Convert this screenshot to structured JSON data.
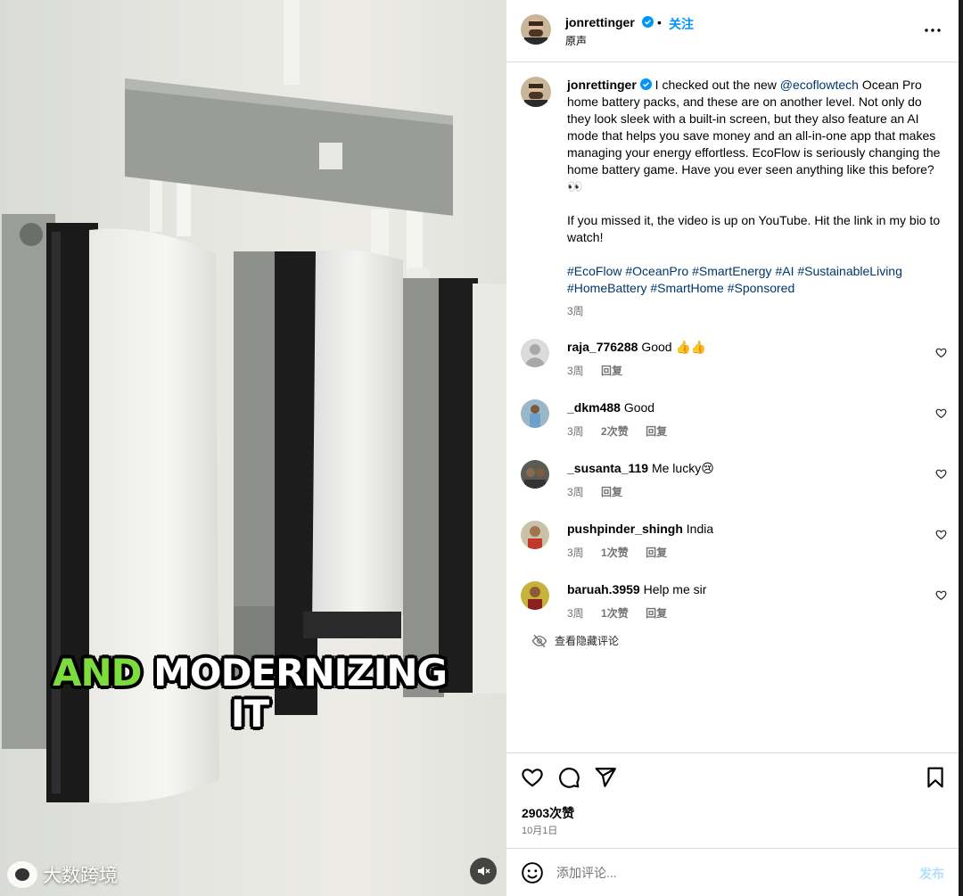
{
  "media": {
    "caption_accent": "AND",
    "caption_rest": "MODERNIZING",
    "caption_line2": "IT",
    "watermark": "大数跨境",
    "mute_icon": "speaker-muted-icon"
  },
  "header": {
    "username": "jonrettinger",
    "dot": "•",
    "follow_label": "关注",
    "subtitle": "原声",
    "more_icon": "more-horizontal-icon"
  },
  "caption": {
    "username": "jonrettinger",
    "text_before_mention": "I checked out the new",
    "mention": "@ecoflowtech",
    "text_after_mention": "Ocean Pro home battery packs, and these are on another level. Not only do they look sleek with a built-in screen, but they also feature an AI mode that helps you save money and an all-in-one app that makes managing your energy effortless. EcoFlow is seriously changing the home battery game. Have you ever seen anything like this before? 👀",
    "paragraph2": "If you missed it, the video is up on YouTube. Hit the link in my bio to watch!",
    "hashtags": "#EcoFlow #OceanPro #SmartEnergy #AI #SustainableLiving #HomeBattery #SmartHome #Sponsored",
    "time": "3周"
  },
  "comments": [
    {
      "username": "raja_776288",
      "text": "Good 👍👍",
      "time": "3周",
      "likes": "",
      "reply": "回复"
    },
    {
      "username": "_dkm488",
      "text": "Good",
      "time": "3周",
      "likes": "2次赞",
      "reply": "回复"
    },
    {
      "username": "_susanta_119",
      "text": "Me lucky😢",
      "time": "3周",
      "likes": "",
      "reply": "回复"
    },
    {
      "username": "pushpinder_shingh",
      "text": "India",
      "time": "3周",
      "likes": "1次赞",
      "reply": "回复"
    },
    {
      "username": "baruah.3959",
      "text": "Help me sir",
      "time": "3周",
      "likes": "1次赞",
      "reply": "回复"
    }
  ],
  "hidden_comments_label": "查看隐藏评论",
  "actions": {
    "likes_count": "2903次赞",
    "date": "10月1日",
    "icons": [
      "heart-icon",
      "comment-icon",
      "share-icon",
      "bookmark-icon"
    ]
  },
  "comment_bar": {
    "placeholder": "添加评论...",
    "post_label": "发布"
  },
  "colors": {
    "link_blue": "#0095f6",
    "caption_accent": "#7ddc3d"
  }
}
